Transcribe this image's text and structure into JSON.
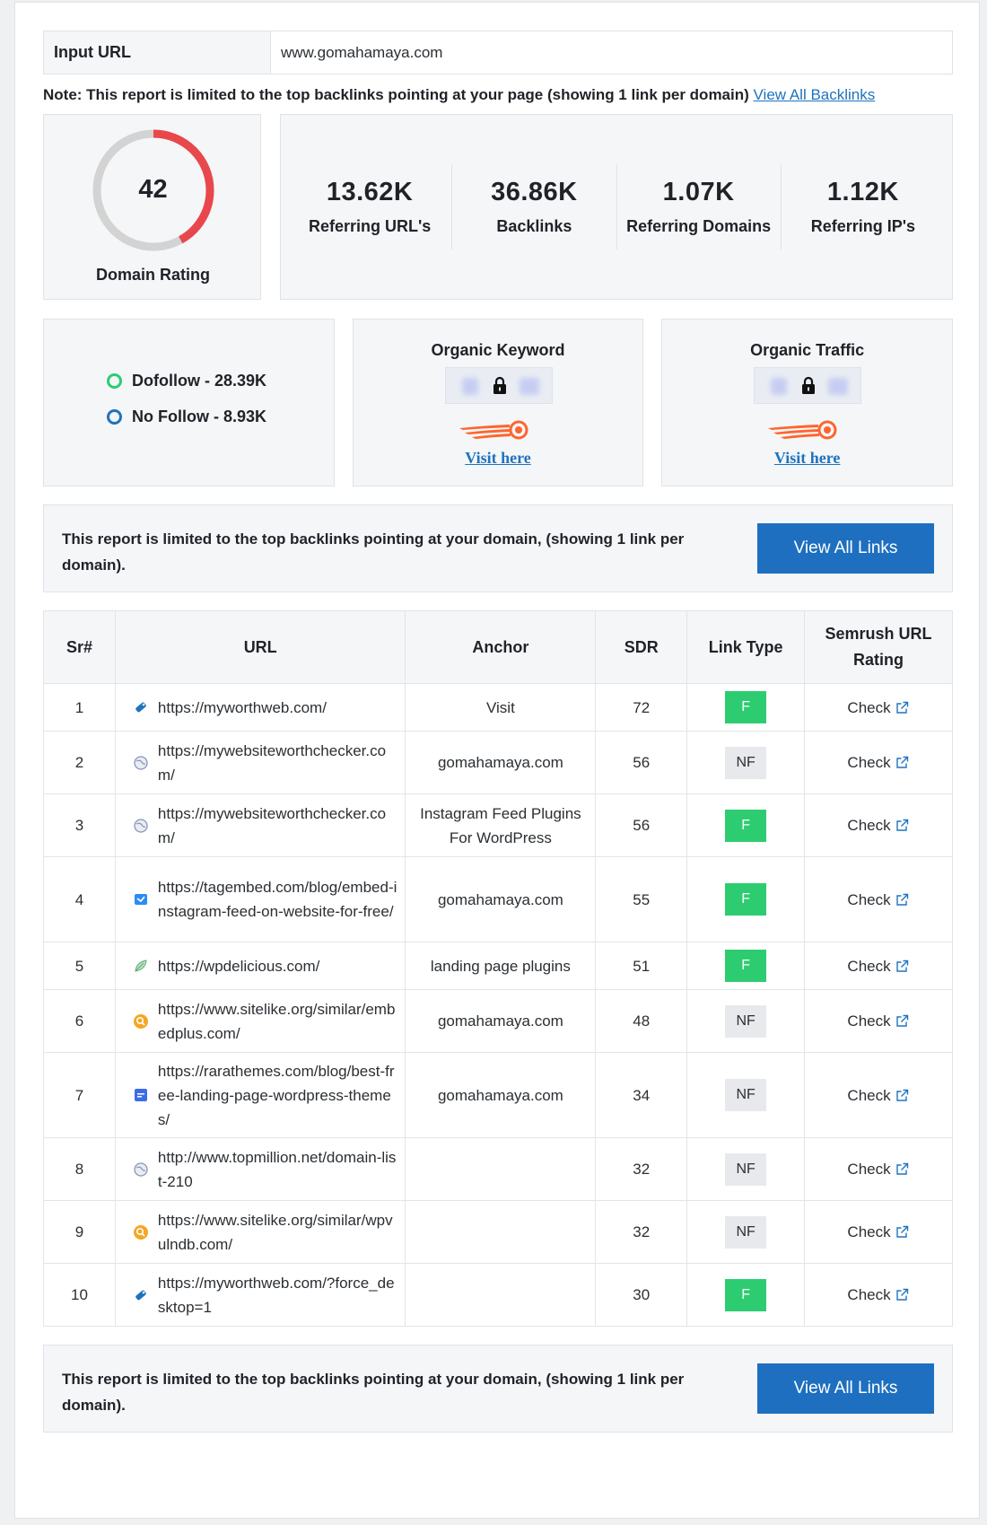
{
  "input": {
    "label": "Input URL",
    "value": "www.gomahamaya.com"
  },
  "note": {
    "text": "Note: This report is limited to the top backlinks pointing at your page (showing 1 link per domain)",
    "link": "View All Backlinks"
  },
  "domain_rating": {
    "value": "42",
    "label": "Domain Rating",
    "fraction": 0.42
  },
  "metrics": [
    {
      "value": "13.62K",
      "label": "Referring URL's"
    },
    {
      "value": "36.86K",
      "label": "Backlinks"
    },
    {
      "value": "1.07K",
      "label": "Referring Domains"
    },
    {
      "value": "1.12K",
      "label": "Referring IP's"
    }
  ],
  "follow": {
    "dofollow": "Dofollow - 28.39K",
    "nofollow": "No Follow - 8.93K"
  },
  "organic_keyword": {
    "title": "Organic Keyword",
    "link": "Visit here"
  },
  "organic_traffic": {
    "title": "Organic Traffic",
    "link": "Visit here"
  },
  "notice": {
    "text": "This report is limited to the top backlinks pointing at your domain, (showing 1 link per domain).",
    "button": "View All Links"
  },
  "table": {
    "headers": {
      "sr": "Sr#",
      "url": "URL",
      "anchor": "Anchor",
      "sdr": "SDR",
      "link_type": "Link Type",
      "semrush": "Semrush URL Rating"
    },
    "check_label": "Check",
    "rows": [
      {
        "sr": "1",
        "url": "https://myworthweb.com/",
        "anchor": "Visit",
        "sdr": "72",
        "type": "F",
        "icon": "tag-icon"
      },
      {
        "sr": "2",
        "url": "https://mywebsiteworthchecker.com/",
        "anchor": "gomahamaya.com",
        "sdr": "56",
        "type": "NF",
        "icon": "globe-icon"
      },
      {
        "sr": "3",
        "url": "https://mywebsiteworthchecker.com/",
        "anchor": "Instagram Feed Plugins For WordPress",
        "sdr": "56",
        "type": "F",
        "icon": "globe-icon"
      },
      {
        "sr": "4",
        "url": "https://tagembed.com/blog/embed-instagram-feed-on-website-for-free/",
        "anchor": "gomahamaya.com",
        "sdr": "55",
        "type": "F",
        "icon": "tagembed-icon"
      },
      {
        "sr": "5",
        "url": "https://wpdelicious.com/",
        "anchor": "landing page plugins",
        "sdr": "51",
        "type": "F",
        "icon": "leaf-icon"
      },
      {
        "sr": "6",
        "url": "https://www.sitelike.org/similar/embedplus.com/",
        "anchor": "gomahamaya.com",
        "sdr": "48",
        "type": "NF",
        "icon": "sitelike-icon"
      },
      {
        "sr": "7",
        "url": "https://rarathemes.com/blog/best-free-landing-page-wordpress-themes/",
        "anchor": "gomahamaya.com",
        "sdr": "34",
        "type": "NF",
        "icon": "rarathemes-icon"
      },
      {
        "sr": "8",
        "url": "http://www.topmillion.net/domain-list-210",
        "anchor": "",
        "sdr": "32",
        "type": "NF",
        "icon": "globe-icon"
      },
      {
        "sr": "9",
        "url": "https://www.sitelike.org/similar/wpvulndb.com/",
        "anchor": "",
        "sdr": "32",
        "type": "NF",
        "icon": "sitelike-icon"
      },
      {
        "sr": "10",
        "url": "https://myworthweb.com/?force_desktop=1",
        "anchor": "",
        "sdr": "30",
        "type": "F",
        "icon": "tag-icon"
      }
    ]
  },
  "colors": {
    "accent": "#1e6fbf",
    "dofollow_green": "#2ecc71",
    "rating_red": "#e8474c",
    "semrush_orange": "#ff642d"
  }
}
